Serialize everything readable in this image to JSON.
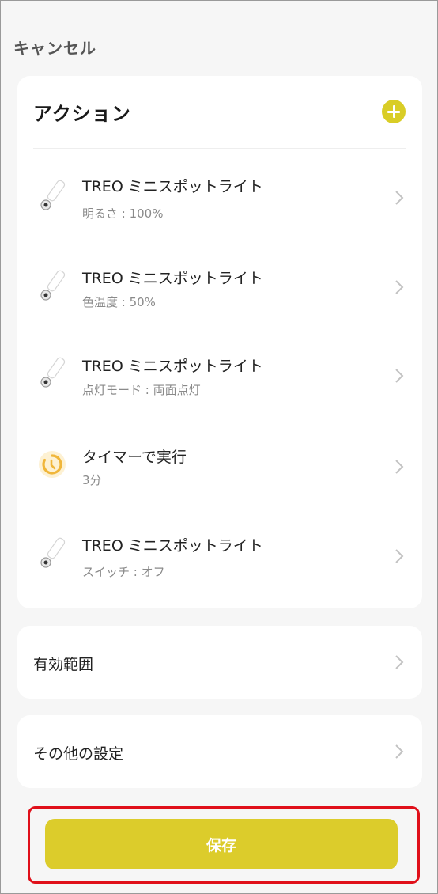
{
  "header": {
    "cancel_label": "キャンセル"
  },
  "actions": {
    "title": "アクション",
    "items": [
      {
        "icon": "spotlight-icon",
        "name": "TREO ミニスポットライト",
        "detail": "明るさ : 100%"
      },
      {
        "icon": "spotlight-icon",
        "name": "TREO ミニスポットライト",
        "detail": "色温度 : 50%"
      },
      {
        "icon": "spotlight-icon",
        "name": "TREO ミニスポットライト",
        "detail": "点灯モード : 両面点灯"
      },
      {
        "icon": "timer-icon",
        "name": "タイマーで実行",
        "detail": "3分"
      },
      {
        "icon": "spotlight-icon",
        "name": "TREO ミニスポットライト",
        "detail": "スイッチ : オフ"
      }
    ]
  },
  "scope": {
    "label": "有効範囲"
  },
  "other_settings": {
    "label": "その他の設定"
  },
  "save": {
    "label": "保存"
  },
  "colors": {
    "accent": "#dccc2b",
    "highlight_border": "#e0101a",
    "timer": "#f0b63a"
  }
}
